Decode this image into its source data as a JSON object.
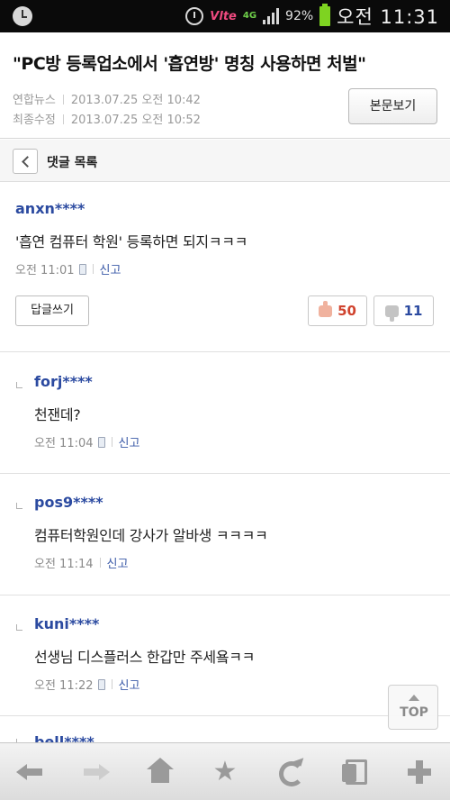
{
  "status_bar": {
    "network_label": "Vlte",
    "data_label": "4G",
    "battery_percent": "92%",
    "time": "오전 11:31"
  },
  "article": {
    "title": "\"PC방 등록업소에서 '흡연방' 명칭 사용하면 처벌\"",
    "source": "연합뉴스",
    "published": "2013.07.25 오전 10:42",
    "modified_label": "최종수정",
    "modified": "2013.07.25 오전 10:52",
    "view_original_label": "본문보기"
  },
  "comment_list": {
    "title": "댓글 목록"
  },
  "comments": [
    {
      "user": "anxn****",
      "text": "'흡연 컴퓨터 학원' 등록하면 되지ㅋㅋㅋ",
      "time": "오전 11:01",
      "mobile": true,
      "report_label": "신고",
      "reply_button": "답글쓰기",
      "likes": "50",
      "dislikes": "11"
    },
    {
      "user": "forj****",
      "text": "천잰데?",
      "time": "오전 11:04",
      "mobile": true,
      "report_label": "신고"
    },
    {
      "user": "pos9****",
      "text": "컴퓨터학원인데 강사가 알바생 ㅋㅋㅋㅋ",
      "time": "오전 11:14",
      "mobile": false,
      "report_label": "신고"
    },
    {
      "user": "kuni****",
      "text": "선생님 디스플러스 한갑만 주세욬ㅋㅋ",
      "time": "오전 11:22",
      "mobile": true,
      "report_label": "신고"
    },
    {
      "user": "bell****"
    }
  ],
  "top_button_label": "TOP",
  "toolbar": {
    "icons": [
      "back-arrow-icon",
      "forward-arrow-icon",
      "home-icon",
      "star-icon",
      "refresh-icon",
      "tabs-icon",
      "plus-icon"
    ]
  },
  "colors": {
    "username": "#2b4aa0",
    "like_count": "#d0432e",
    "dislike_count": "#2b4aa0"
  }
}
